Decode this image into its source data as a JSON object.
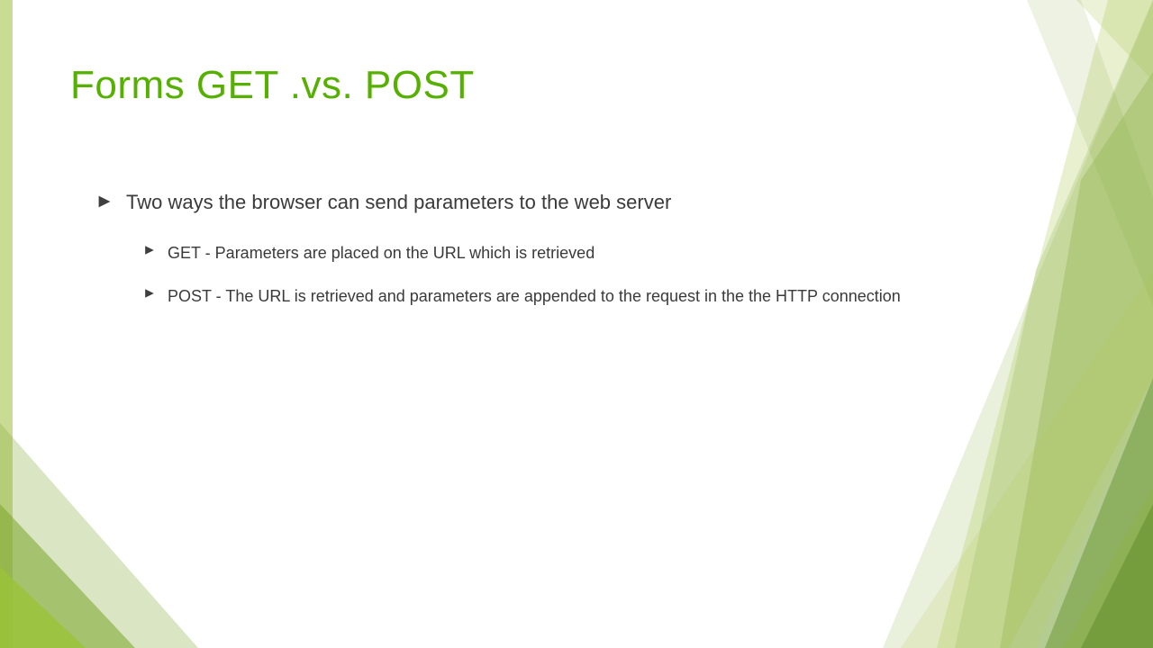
{
  "title": "Forms GET .vs. POST",
  "bullets": {
    "main": "Two ways the browser can send parameters to the web server",
    "sub1": "GET - Parameters are placed on the URL which is retrieved",
    "sub2": "POST - The URL is retrieved and parameters are appended to the request in the the HTTP connection"
  },
  "colors": {
    "accent": "#56b000",
    "bullet": "#3f3f3f"
  }
}
